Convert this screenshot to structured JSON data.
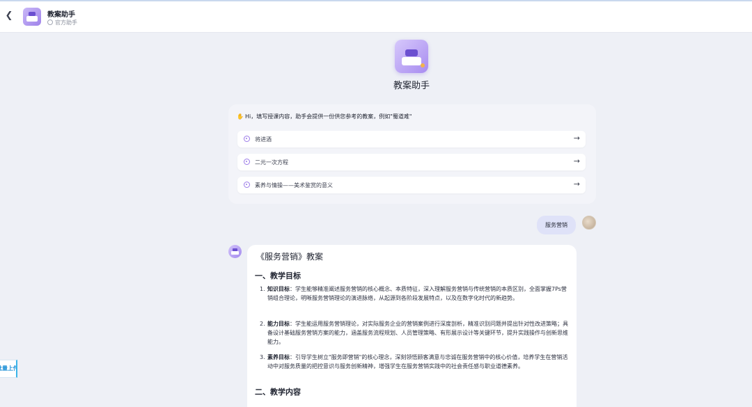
{
  "header": {
    "back_icon": "chevron-left-icon",
    "title": "教案助手",
    "subtitle": "官方助手"
  },
  "hero": {
    "title": "教案助手"
  },
  "welcome": {
    "text": "Hi，填写授课内容，助手会提供一份供您参考的教案，例如\"蜀道难\"",
    "suggestions": [
      {
        "label": "将进酒"
      },
      {
        "label": "二元一次方程"
      },
      {
        "label": "素养与情操——美术鉴赏的意义"
      }
    ]
  },
  "user_message": {
    "text": "服务营销"
  },
  "answer": {
    "title": "《服务营销》教案",
    "section1": "一、教学目标",
    "items": [
      {
        "num": "1.",
        "term": "知识目标",
        "text": "：学生能够精准阐述服务营销的核心概念、本质特征，深入理解服务营销与传统营销的本质区别，全面掌握7Ps营销组合理论，明晰服务营销理论的演进脉络，从起源到各阶段发展特点，以及在数字化时代的新趋势。"
      },
      {
        "num": "2.",
        "term": "能力目标",
        "text": "：学生能运用服务营销理论，对实际服务企业的营销案例进行深度剖析，精准识别问题并提出针对性改进策略；具备设计基础服务营销方案的能力，涵盖服务流程规划、人员管理策略、有形展示设计等关键环节，提升实践操作与创新思维能力。"
      },
      {
        "num": "3.",
        "term": "素养目标",
        "text": "：引导学生树立\"服务即营销\"的核心理念，深刻领悟顾客满意与忠诚在服务营销中的核心价值，培养学生在营销活动中对服务质量的把控意识与服务创新精神，增强学生在服务营销实践中的社会责任感与职业道德素养。"
      }
    ],
    "section2": "二、教学内容"
  },
  "side_tab": {
    "label": "批量上传"
  }
}
